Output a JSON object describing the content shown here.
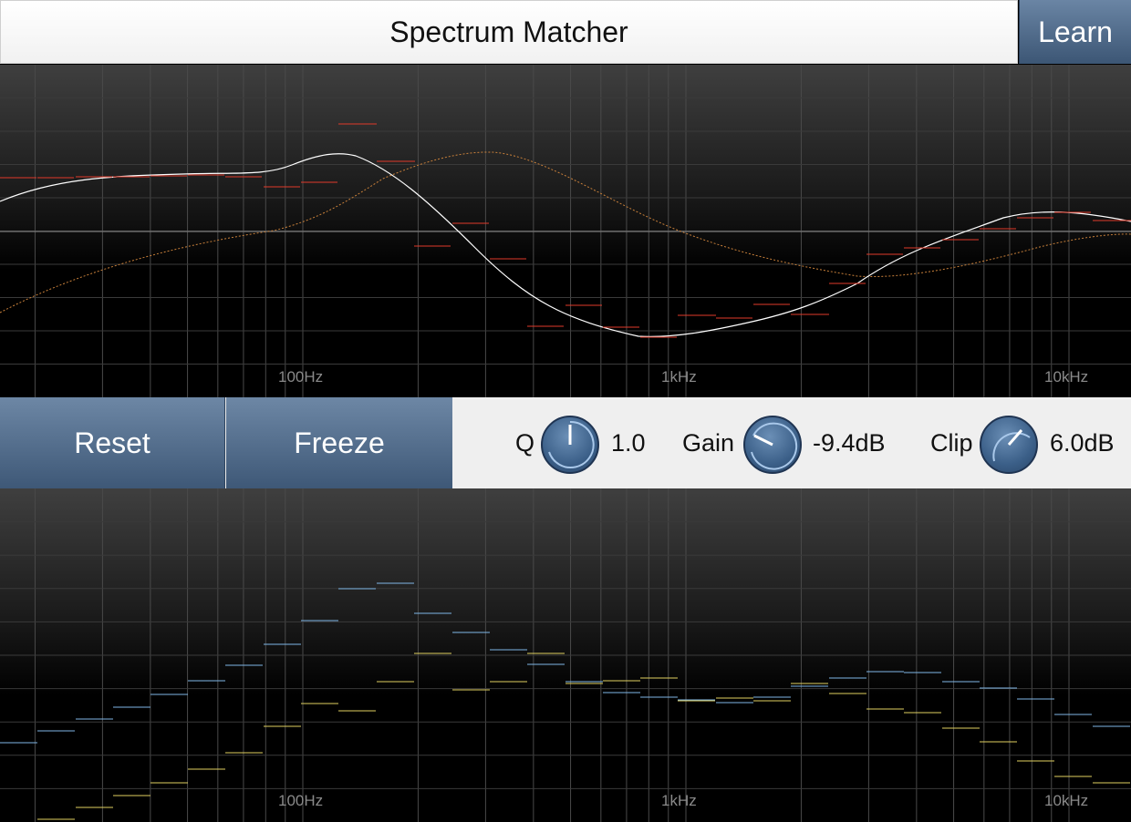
{
  "header": {
    "title": "Spectrum Matcher",
    "learn_label": "Learn"
  },
  "frequency_axis": {
    "labels": [
      "100Hz",
      "1kHz",
      "10kHz"
    ]
  },
  "controls": {
    "reset_label": "Reset",
    "freeze_label": "Freeze",
    "knobs": [
      {
        "label": "Q",
        "value": "1.0"
      },
      {
        "label": "Gain",
        "value": "-9.4dB"
      },
      {
        "label": "Clip",
        "value": "6.0dB"
      }
    ]
  },
  "colors": {
    "accent_button": "#4f6b8c",
    "eq_curve": "#ffffff",
    "reference_curve": "#c9803a",
    "band_marker": "#e03a2a",
    "source_spectrum": "#7fb6e6",
    "target_spectrum": "#e0d060"
  }
}
